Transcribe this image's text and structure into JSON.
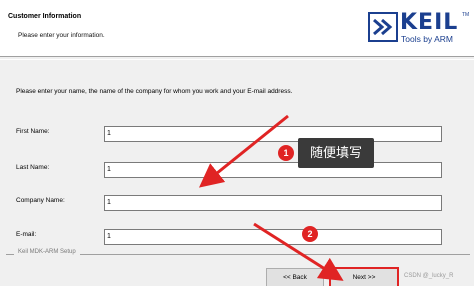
{
  "header": {
    "title": "Customer Information",
    "subtitle": "Please enter your information."
  },
  "logo": {
    "word": "KEIL",
    "tm": "TM",
    "tagline": "Tools by ARM",
    "color": "#1b3f8f"
  },
  "form": {
    "intro": "Please enter your name, the name of the company for whom you work and your E-mail address.",
    "fields": [
      {
        "label": "First Name:",
        "value": "1"
      },
      {
        "label": "Last Name:",
        "value": "1"
      },
      {
        "label": "Company Name:",
        "value": "1"
      },
      {
        "label": "E-mail:",
        "value": "1"
      }
    ]
  },
  "footer": {
    "group_label": "Keil MDK-ARM Setup",
    "next_label": "Next >>",
    "back_label": "<< Back",
    "watermark": "CSDN @_lucky_R"
  },
  "annotations": {
    "badge1": "1",
    "badge2": "2",
    "note": "随便填写",
    "arrow_color": "#e02424"
  }
}
